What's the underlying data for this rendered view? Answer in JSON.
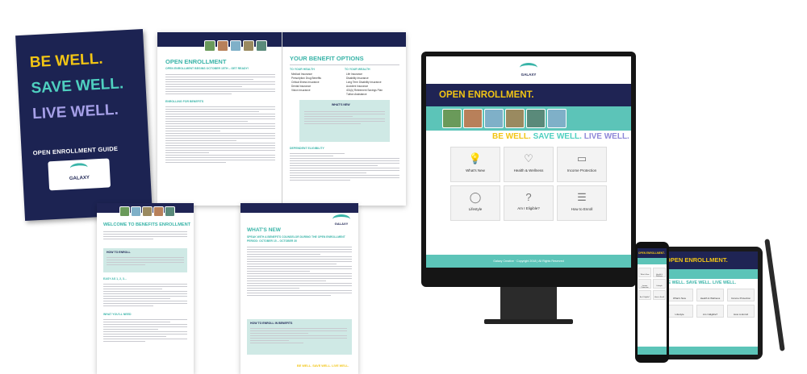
{
  "cover": {
    "line1": "BE WELL.",
    "line2": "SAVE WELL.",
    "line3": "LIVE WELL.",
    "guide_title": "OPEN ENROLLMENT GUIDE",
    "logo_text": "GALAXY",
    "colors": {
      "be": "#f2c514",
      "save": "#4fd0c0",
      "live": "#a6a0e8",
      "navy": "#1c2352"
    }
  },
  "book": {
    "left_title": "OPEN ENROLLMENT",
    "left_subtitle": "OPEN ENROLLMENT BEGINS OCTOBER 15TH – GET READY!",
    "left_section": "ENROLLING FOR BENEFITS",
    "right_title": "YOUR BENEFIT OPTIONS",
    "health_heading": "TO YOUR HEALTH",
    "health_items": [
      "Medical Insurance",
      "Prescription Drug Benefits",
      "Critical Illness Insurance",
      "Dental Insurance",
      "Vision Insurance"
    ],
    "wealth_heading": "TO YOUR WEALTH",
    "wealth_items": [
      "Life Insurance",
      "Disability Insurance",
      "Long Term Disability Insurance",
      "Accident Insurance",
      "401(k) Retirement Savings Plan",
      "Tuition Assistance"
    ],
    "whats_new": "WHAT'S NEW",
    "dependent": "DEPENDENT ELIGIBILITY"
  },
  "page_welcome": {
    "title": "WELCOME TO BENEFITS ENROLLMENT",
    "box_title": "HOW TO ENROLL",
    "steps_heading": "EASY AS 1, 2, 3...",
    "need_heading": "WHAT YOU'LL NEED"
  },
  "page_new": {
    "title": "WHAT'S NEW",
    "subtitle": "SPEAK WITH A BENEFITS COUNSELOR DURING THE OPEN ENROLLMENT PERIOD: OCTOBER 15 – OCTOBER 30",
    "box_title": "HOW TO ENROLL IN BENEFITS",
    "footer": "BE WELL. SAVE WELL. LIVE WELL.",
    "logo_text": "GALAXY"
  },
  "monitor": {
    "logo_text": "GALAXY",
    "banner": "OPEN ENROLLMENT.",
    "tagline_be": "BE WELL.",
    "tagline_save": "SAVE WELL.",
    "tagline_live": "LIVE WELL.",
    "tiles": [
      {
        "label": "What's New",
        "icon": "lightbulb-icon",
        "glyph": "💡"
      },
      {
        "label": "Health & Wellness",
        "icon": "heart-icon",
        "glyph": "♡"
      },
      {
        "label": "Income Protection",
        "icon": "wallet-icon",
        "glyph": "▭"
      },
      {
        "label": "Lifestyle",
        "icon": "balloon-icon",
        "glyph": "◯"
      },
      {
        "label": "Am I Eligible?",
        "icon": "question-icon",
        "glyph": "?"
      },
      {
        "label": "How to Enroll",
        "icon": "document-icon",
        "glyph": "☰"
      }
    ],
    "footer": "Galaxy Creative · Copyright 2018 | All Rights Reserved"
  },
  "tablet": {
    "banner": "OPEN ENROLLMENT.",
    "tagline": "BE WELL. SAVE WELL. LIVE WELL.",
    "tiles": [
      "What's New",
      "Health & Wellness",
      "Income Protection",
      "Lifestyle",
      "Am I Eligible?",
      "How to Enroll"
    ]
  },
  "phone": {
    "banner": "OPEN ENROLLMENT.",
    "tiles": [
      "What's New",
      "Health & Wellness",
      "Income Protection",
      "Lifestyle",
      "Am I Eligible?",
      "How to Enroll"
    ]
  }
}
